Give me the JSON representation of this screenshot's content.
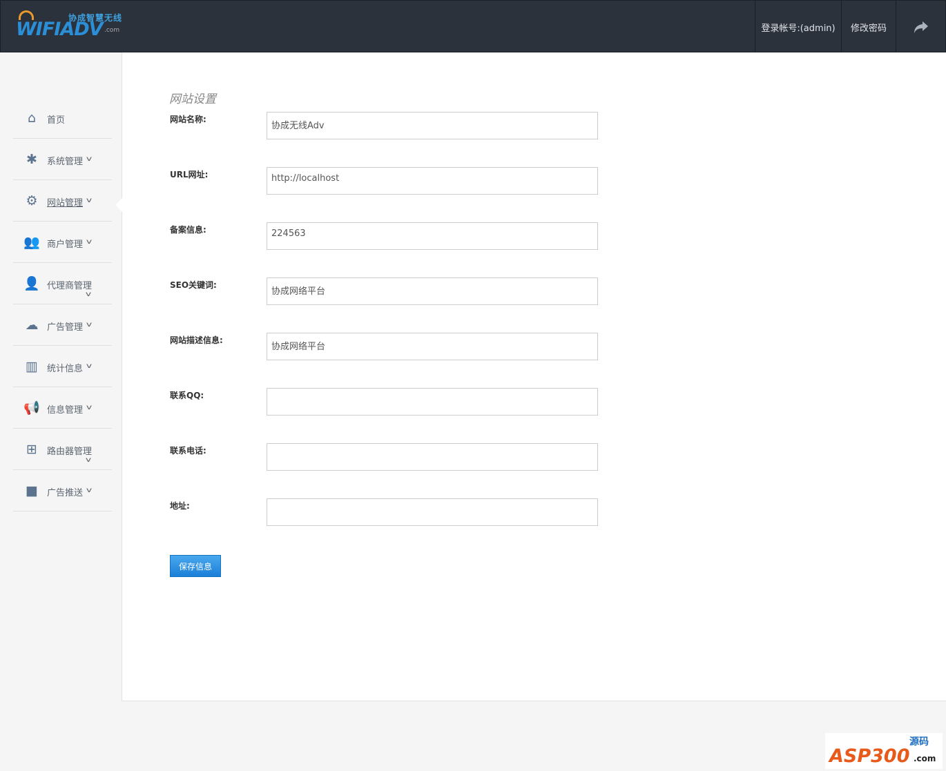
{
  "header": {
    "logo_cn": "协成智慧无线",
    "logo_en": "WIFIADV",
    "logo_com": ".com",
    "account": "登录帐号:(admin)",
    "change_password": "修改密码",
    "logout_icon": "share-arrow-icon"
  },
  "sidebar": {
    "items": [
      {
        "label": "首页",
        "icon": "home-icon",
        "chevron": false
      },
      {
        "label": "系统管理",
        "icon": "asterisk-icon",
        "chevron": true
      },
      {
        "label": "网站管理",
        "icon": "cogs-icon",
        "chevron": true,
        "active": true
      },
      {
        "label": "商户管理",
        "icon": "users-icon",
        "chevron": true
      },
      {
        "label": "代理商管理",
        "icon": "user-md-icon",
        "chevron": true,
        "wrap": true
      },
      {
        "label": "广告管理",
        "icon": "cloud-icon",
        "chevron": true
      },
      {
        "label": "统计信息",
        "icon": "bar-chart-icon",
        "chevron": true
      },
      {
        "label": "信息管理",
        "icon": "bullhorn-icon",
        "chevron": true
      },
      {
        "label": "路由器管理",
        "icon": "sitemap-icon",
        "chevron": true,
        "wrap": true
      },
      {
        "label": "广告推送",
        "icon": "video-camera-icon",
        "chevron": true
      }
    ]
  },
  "main": {
    "title": "网站设置",
    "fields": [
      {
        "label": "网站名称:",
        "value": "协成无线Adv"
      },
      {
        "label": "URL网址:",
        "value": "http://localhost"
      },
      {
        "label": "备案信息:",
        "value": "224563"
      },
      {
        "label": "SEO关键词:",
        "value": "协成网络平台"
      },
      {
        "label": "网站描述信息:",
        "value": "协成网络平台"
      },
      {
        "label": "联系QQ:",
        "value": ""
      },
      {
        "label": "联系电话:",
        "value": ""
      },
      {
        "label": "地址:",
        "value": ""
      }
    ],
    "save_label": "保存信息"
  },
  "watermark": {
    "text": "ASP300",
    "cn": "源码",
    "com": ".com"
  }
}
